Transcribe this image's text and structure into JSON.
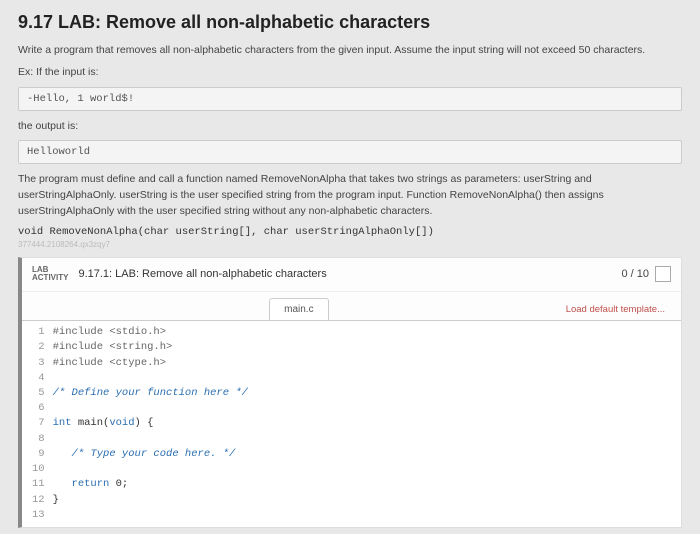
{
  "title": "9.17 LAB: Remove all non-alphabetic characters",
  "intro": "Write a program that removes all non-alphabetic characters from the given input. Assume the input string will not exceed 50 characters.",
  "ex_if_input": "Ex: If the input is:",
  "input_example": "-Hello, 1 world$!",
  "output_is": "the output is:",
  "output_example": "Helloworld",
  "explain": "The program must define and call a function named RemoveNonAlpha that takes two strings as parameters: userString and userStringAlphaOnly. userString is the user specified string from the program input. Function RemoveNonAlpha() then assigns userStringAlphaOnly with the user specified string without any non-alphabetic characters.",
  "signature": "void RemoveNonAlpha(char userString[], char userStringAlphaOnly[])",
  "watermark": "377444.2108264.qx3zqy7",
  "activity": {
    "badge_line1": "LAB",
    "badge_line2": "ACTIVITY",
    "title": "9.17.1: LAB: Remove all non-alphabetic characters",
    "score": "0 / 10",
    "tab": "main.c",
    "load_template": "Load default template..."
  },
  "code_lines": [
    {
      "n": 1,
      "html": "<span class='pp'>#include &lt;stdio.h&gt;</span>"
    },
    {
      "n": 2,
      "html": "<span class='pp'>#include &lt;string.h&gt;</span>"
    },
    {
      "n": 3,
      "html": "<span class='pp'>#include &lt;ctype.h&gt;</span>"
    },
    {
      "n": 4,
      "html": ""
    },
    {
      "n": 5,
      "html": "<span class='cm'>/* Define your function here */</span>"
    },
    {
      "n": 6,
      "html": ""
    },
    {
      "n": 7,
      "html": "<span class='kw'>int</span> main(<span class='kw'>void</span>) {"
    },
    {
      "n": 8,
      "html": ""
    },
    {
      "n": 9,
      "html": "   <span class='cm'>/* Type your code here. */</span>"
    },
    {
      "n": 10,
      "html": ""
    },
    {
      "n": 11,
      "html": "   <span class='kw'>return</span> 0;"
    },
    {
      "n": 12,
      "html": "}"
    },
    {
      "n": 13,
      "html": ""
    }
  ]
}
